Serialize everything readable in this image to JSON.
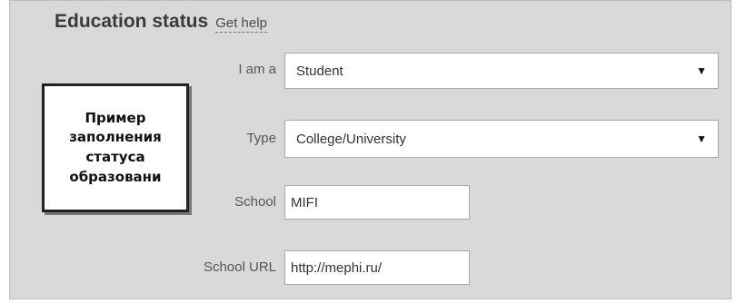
{
  "header": {
    "title": "Education status",
    "help_link": "Get help"
  },
  "form": {
    "i_am_a": {
      "label": "I am a",
      "value": "Student"
    },
    "type": {
      "label": "Type",
      "value": "College/University"
    },
    "school": {
      "label": "School",
      "value": "MIFI"
    },
    "school_url": {
      "label": "School URL",
      "value": "http://mephi.ru/"
    }
  },
  "note": {
    "lines": [
      "Пример",
      "заполнения",
      "статуса",
      "образовани"
    ]
  }
}
